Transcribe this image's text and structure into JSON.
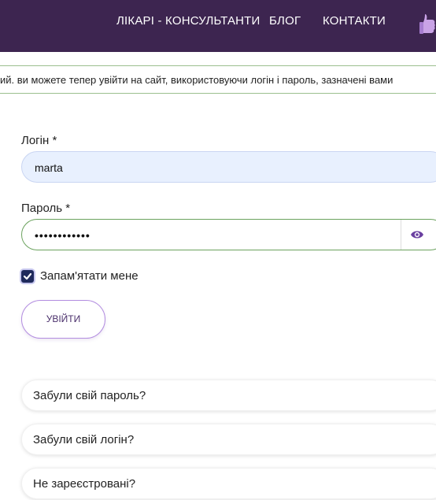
{
  "nav": {
    "items": [
      "ЛІКАРІ - КОНСУЛЬТАНТИ",
      "БЛОГ",
      "КОНТАКТИ"
    ],
    "icon": "thumbs-up-icon"
  },
  "notice": {
    "text": "ий. ви можете тепер увійти на сайт, використовуючи логін і пароль, зазначені вами"
  },
  "form": {
    "login_label": "Логін *",
    "login_value": "marta",
    "password_label": "Пароль *",
    "password_value": "••••••••••••",
    "remember_label": "Запам'ятати мене",
    "remember_checked": true,
    "submit_label": "УВІЙТИ"
  },
  "links": [
    "Забули свій пароль?",
    "Забули свій логін?",
    "Не зареєстровані?"
  ],
  "colors": {
    "navbar": "#3d2550",
    "accent": "#b38de0",
    "checkbox": "#1f2a5c",
    "notice_border": "#9bbf8e"
  }
}
